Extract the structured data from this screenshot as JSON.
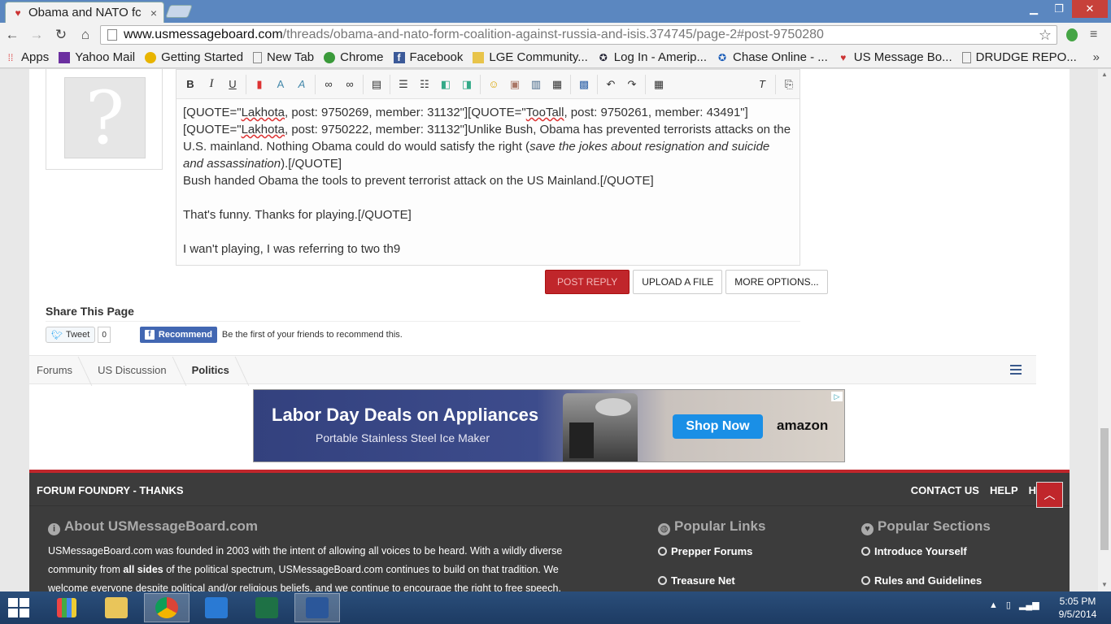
{
  "browser": {
    "tab_title": "Obama and NATO fc",
    "url_host": "www.usmessageboard.com",
    "url_path": "/threads/obama-and-nato-form-coalition-against-russia-and-isis.374745/page-2#post-9750280",
    "bookmarks": [
      "Apps",
      "Yahoo Mail",
      "Getting Started",
      "New Tab",
      "Chrome",
      "Facebook",
      "LGE Community...",
      "Log In - Amerip...",
      "Chase Online - ...",
      "US Message Bo...",
      "DRUDGE REPO..."
    ],
    "bookmarks_more": "»"
  },
  "editor": {
    "line1_a": "[QUOTE=\"",
    "line1_name1": "Lakhota",
    "line1_b": ", post: 9750269, member: 31132\"][QUOTE=\"",
    "line1_name2": "TooTall",
    "line1_c": ", post: 9750261, member: 43491\"]",
    "line2_a": "[QUOTE=\"",
    "line2_name": "Lakhota",
    "line2_b": ", post: 9750222, member: 31132\"]Unlike Bush, Obama has prevented terrorists attacks on the U.S. mainland.  Nothing Obama could do would satisfy the right (",
    "line2_em": "save the jokes about resignation and suicide and assassination",
    "line2_c": ").[/QUOTE]",
    "line3": "Bush handed Obama the tools to prevent terrorist attack on the US Mainland.[/QUOTE]",
    "line4": "That's funny.  Thanks for playing.[/QUOTE]",
    "line5": "I wan't playing, I was referring to two th9"
  },
  "buttons": {
    "post_reply": "POST REPLY",
    "upload": "UPLOAD A FILE",
    "more_options": "MORE OPTIONS..."
  },
  "share": {
    "title": "Share This Page",
    "tweet": "Tweet",
    "tweet_count": "0",
    "recommend": "Recommend",
    "fb_text": "Be the first of your friends to recommend this."
  },
  "breadcrumb": [
    "Forums",
    "US Discussion",
    "Politics"
  ],
  "ad": {
    "headline": "Labor Day Deals on Appliances",
    "sub": "Portable Stainless Steel Ice Maker",
    "cta": "Shop Now",
    "brand": "amazon"
  },
  "footer": {
    "brand": "FORUM FOUNDRY - THANKS",
    "links": [
      "CONTACT US",
      "HELP",
      "HOM"
    ],
    "about_title": "About USMessageBoard.com",
    "about_1": "USMessageBoard.com was founded in 2003 with the intent of allowing all voices to be heard. With a wildly diverse community from ",
    "about_bold": "all sides",
    "about_2": " of the political spectrum, USMessageBoard.com continues to build on that tradition. We welcome everyone despite political and/or religious beliefs, and we continue to encourage the right to free speech.",
    "popular_links_title": "Popular Links",
    "popular_links": [
      "Prepper Forums",
      "Treasure Net"
    ],
    "popular_sections_title": "Popular Sections",
    "popular_sections": [
      "Introduce Yourself",
      "Rules and Guidelines"
    ]
  },
  "taskbar": {
    "time": "5:05 PM",
    "date": "9/5/2014"
  },
  "colors": {
    "accent_red": "#c0262b",
    "footer_bg": "#3c3c3c",
    "chrome_blue": "#5b87c0"
  }
}
